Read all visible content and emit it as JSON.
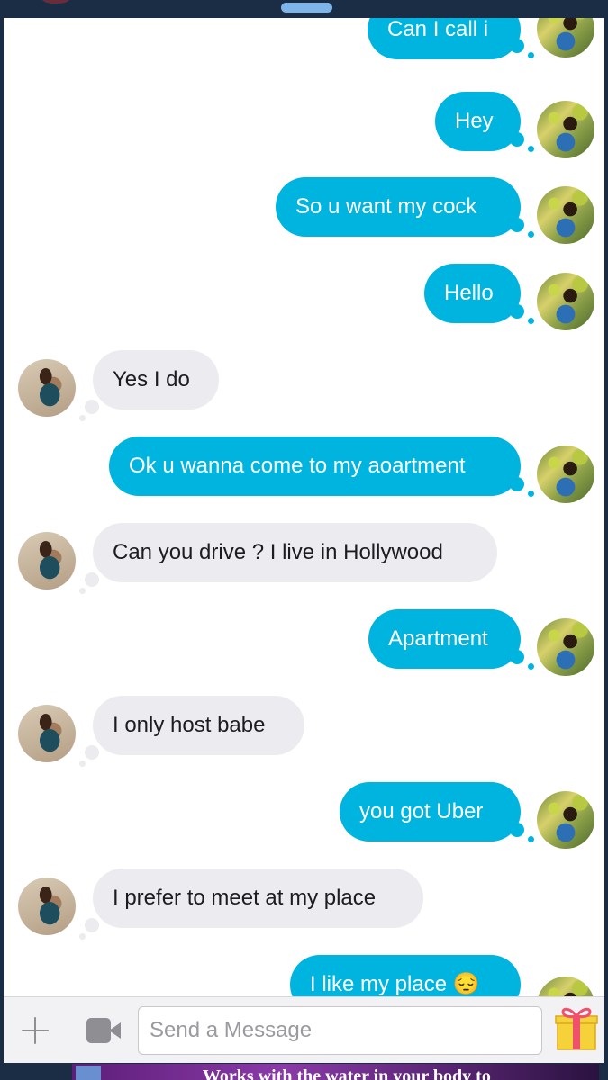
{
  "messages": [
    {
      "dir": "sent",
      "text": "Can I call i"
    },
    {
      "dir": "sent",
      "text": "Hey"
    },
    {
      "dir": "sent",
      "text": "So u want my cock"
    },
    {
      "dir": "sent",
      "text": "Hello"
    },
    {
      "dir": "recv",
      "text": "Yes I do"
    },
    {
      "dir": "sent",
      "text": "Ok u wanna come to my aoartment"
    },
    {
      "dir": "recv",
      "text": "Can you drive ? I live in Hollywood"
    },
    {
      "dir": "sent",
      "text": "Apartment"
    },
    {
      "dir": "recv",
      "text": "I only host babe"
    },
    {
      "dir": "sent",
      "text": "you got Uber"
    },
    {
      "dir": "recv",
      "text": "I prefer to meet at my place"
    },
    {
      "dir": "sent",
      "text": "I like my place 😔"
    }
  ],
  "composer": {
    "placeholder": "Send a Message",
    "plus_icon": "plus-icon",
    "video_icon": "video-camera-icon",
    "gift_icon": "gift-icon"
  },
  "ad": {
    "text": "Works with the water in your body to"
  },
  "colors": {
    "sent_bubble": "#00b4e0",
    "recv_bubble": "#ebebf0",
    "frame": "#1b2d44"
  }
}
